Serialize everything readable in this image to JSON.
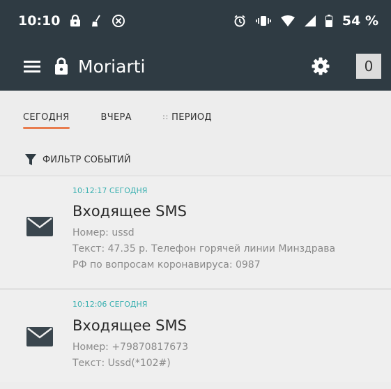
{
  "status": {
    "time": "10:10",
    "battery": "54 %",
    "icons": [
      "lock-icon",
      "broom-icon",
      "blocked-icon",
      "alarm-icon",
      "vibrate-icon",
      "wifi-icon",
      "signal-icon",
      "battery-icon"
    ]
  },
  "toolbar": {
    "title": "Moriarti",
    "counter": "0",
    "icons": [
      "menu-icon",
      "lock-icon",
      "gear-icon"
    ]
  },
  "tabs": [
    {
      "label": "СЕГОДНЯ",
      "active": true
    },
    {
      "label": "ВЧЕРА",
      "active": false
    },
    {
      "label": "ПЕРИОД",
      "active": false
    }
  ],
  "filter": {
    "label": "ФИЛЬТР СОБЫТИЙ"
  },
  "events": [
    {
      "time": "10:12:17 СЕГОДНЯ",
      "title": "Входящее SMS",
      "lines": [
        "Номер: ussd",
        "Текст: 47.35 р. Телефон горячей линии Минздрава",
        "РФ по вопросам коронавируса: 0987"
      ]
    },
    {
      "time": "10:12:06 СЕГОДНЯ",
      "title": "Входящее SMS",
      "lines": [
        "Номер: +79870817673",
        "Текст: Ussd(*102#)"
      ]
    }
  ],
  "colors": {
    "bar": "#2f3b43",
    "accent": "#e87c4e",
    "time": "#3ab0b0"
  }
}
